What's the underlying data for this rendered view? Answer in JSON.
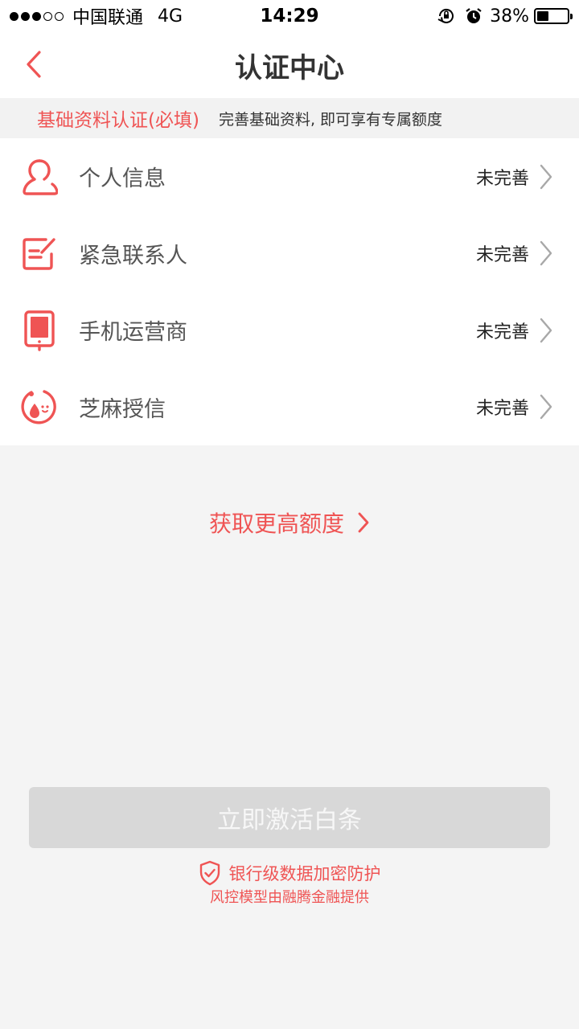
{
  "status_bar": {
    "carrier": "中国联通",
    "network": "4G",
    "time": "14:29",
    "battery_percent": "38%",
    "battery_level": 0.38,
    "signal_filled": 3,
    "signal_total": 5
  },
  "nav": {
    "title": "认证中心",
    "back_icon": "chevron-left-icon"
  },
  "notice": {
    "required_label": "基础资料认证(必填)",
    "description": "完善基础资料, 即可享有专属额度"
  },
  "items": [
    {
      "label": "个人信息",
      "status": "未完善",
      "icon": "person-icon"
    },
    {
      "label": "紧急联系人",
      "status": "未完善",
      "icon": "edit-contact-icon"
    },
    {
      "label": "手机运营商",
      "status": "未完善",
      "icon": "phone-icon"
    },
    {
      "label": "芝麻授信",
      "status": "未完善",
      "icon": "sesame-icon"
    }
  ],
  "more_link": {
    "label": "获取更高额度"
  },
  "activate_button": {
    "label": "立即激活白条"
  },
  "security": {
    "label": "银行级数据加密防护",
    "provider": "风控模型由融腾金融提供"
  },
  "colors": {
    "accent": "#ef5454",
    "button_disabled": "#d8d8d8",
    "background": "#f4f4f4"
  }
}
